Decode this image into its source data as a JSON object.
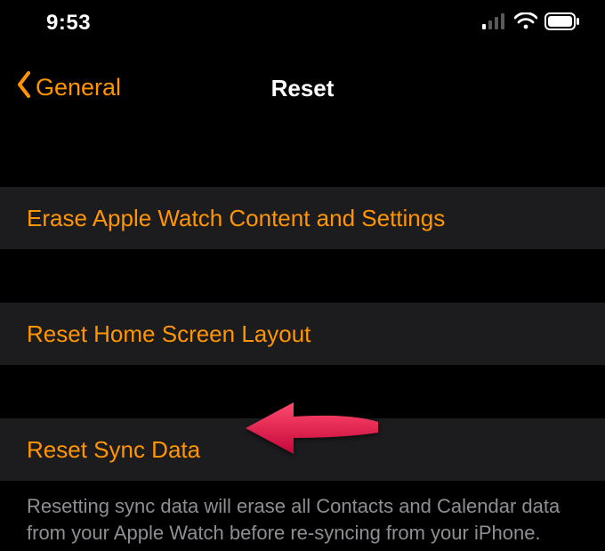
{
  "statusBar": {
    "time": "9:53"
  },
  "nav": {
    "back": "General",
    "title": "Reset"
  },
  "rows": {
    "erase": "Erase Apple Watch Content and Settings",
    "homeLayout": "Reset Home Screen Layout",
    "syncData": "Reset Sync Data"
  },
  "footer": "Resetting sync data will erase all Contacts and Calendar data from your Apple Watch before re-syncing from your iPhone."
}
